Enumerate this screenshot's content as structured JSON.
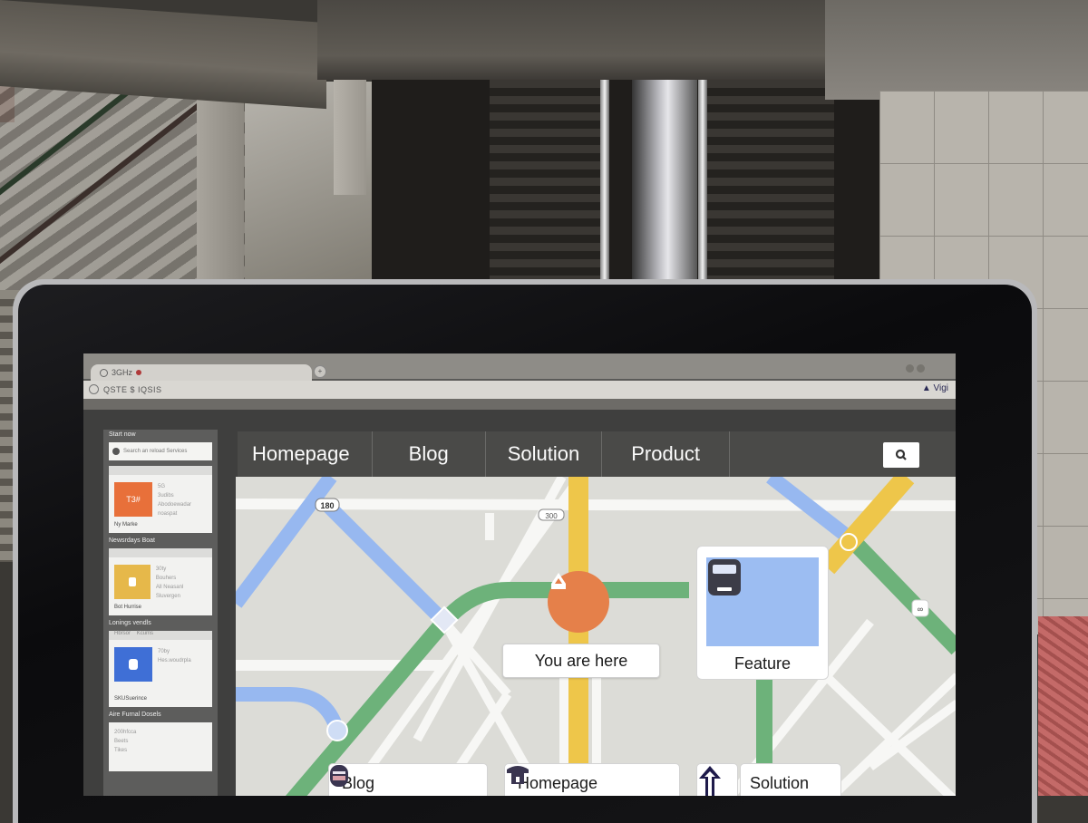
{
  "browser": {
    "tab_title": "3GHz",
    "new_tab_icon": "plus-circle-icon",
    "address_text": "QSTE $ IQSIS",
    "extension_label": "Vigi"
  },
  "sidebar": {
    "header": "Start now",
    "search_placeholder": "Search an reload Services",
    "sections": [
      {
        "title": "",
        "card": {
          "thumb_text": "T3#",
          "thumb_color": "#e8703a",
          "lines": [
            "5G",
            "3udibs",
            "Abodoewadar",
            "noaspat"
          ],
          "footer": "Ny Marke"
        }
      },
      {
        "title": "Newsrdays Boat",
        "card": {
          "thumb_text": "",
          "thumb_color": "#e6b84a",
          "lines": [
            "30ty",
            "Bouhers",
            "All Neasanl Sluvergen"
          ],
          "footer": "Bot Hurrise"
        }
      },
      {
        "title": "Lonings vendls",
        "card": {
          "strip": [
            "Hbrsor",
            "Kcums"
          ],
          "thumb_text": "",
          "thumb_color": "#3f6fd6",
          "lines": [
            "70by",
            "Hes.woudrpla"
          ],
          "footer": "SKUSuerince"
        }
      },
      {
        "title": "Aire Furnal Dosels",
        "card": {
          "lines": [
            "200hfcca",
            "Beets",
            "Tikes"
          ]
        }
      }
    ]
  },
  "nav": {
    "items": [
      "Homepage",
      "Blog",
      "Solution",
      "Product"
    ],
    "search_icon": "search-icon"
  },
  "map": {
    "route_labels": [
      "180",
      "300"
    ],
    "you_are_here": "You are here",
    "feature_label": "Feature",
    "colors": {
      "background": "#dcdcd7",
      "road": "#f7f7f5",
      "blue_line": "#97b8f0",
      "green_line": "#6db27a",
      "yellow_line": "#eec64a",
      "pin": "#e5804a"
    },
    "bottom_buttons": [
      {
        "label": "Blog",
        "icon": "bus-icon"
      },
      {
        "label": "Homepage",
        "icon": "phone-icon"
      },
      {
        "label": "Solution",
        "icon": "up-arrow-icon"
      }
    ]
  }
}
